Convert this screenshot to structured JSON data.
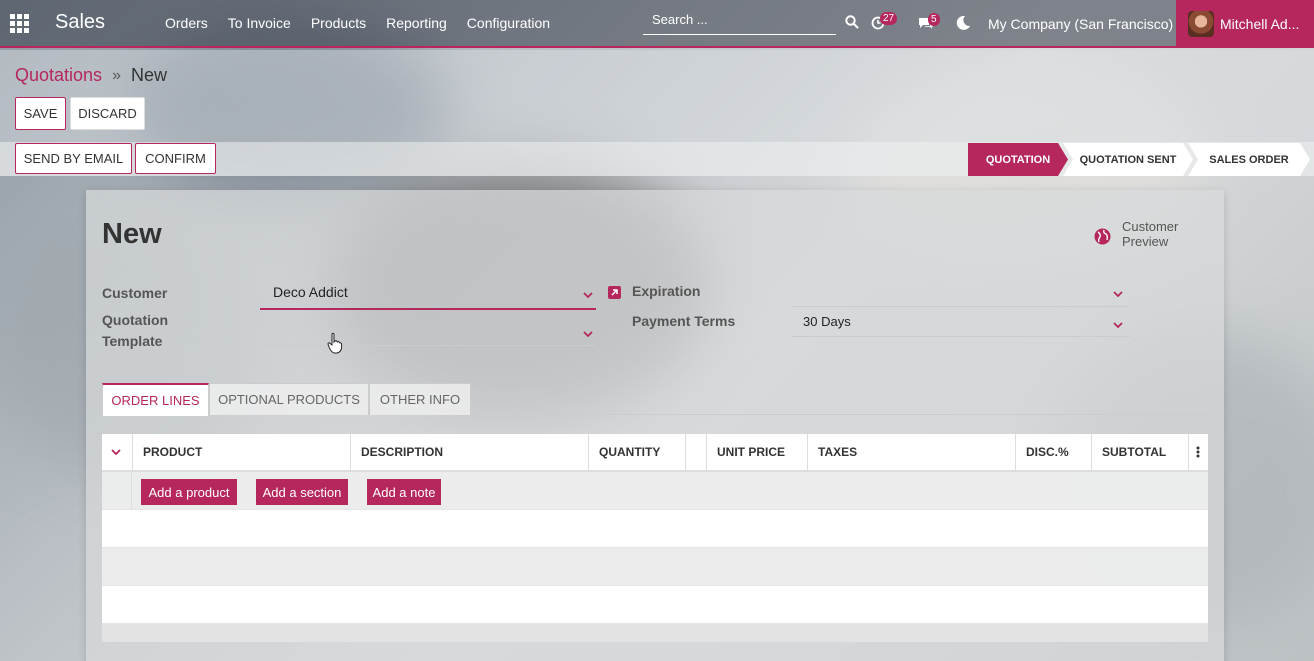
{
  "navbar": {
    "app_name": "Sales",
    "menu": [
      "Orders",
      "To Invoice",
      "Products",
      "Reporting",
      "Configuration"
    ],
    "search_placeholder": "Search ...",
    "activity_count": "27",
    "message_count": "5",
    "company": "My Company (San Francisco)",
    "user": "Mitchell Ad..."
  },
  "breadcrumb": {
    "parent": "Quotations",
    "current": "New"
  },
  "buttons": {
    "save": "SAVE",
    "discard": "DISCARD",
    "send_by_email": "SEND BY EMAIL",
    "confirm": "CONFIRM"
  },
  "statusbar": {
    "stages": [
      "QUOTATION",
      "QUOTATION SENT",
      "SALES ORDER"
    ],
    "active": "QUOTATION"
  },
  "form": {
    "title": "New",
    "customer_preview": "Customer Preview",
    "customer_label": "Customer",
    "customer_value": "Deco Addict",
    "template_label_1": "Quotation",
    "template_label_2": "Template",
    "template_value": "",
    "expiration_label": "Expiration",
    "expiration_value": "",
    "payment_terms_label": "Payment Terms",
    "payment_terms_value": "30 Days"
  },
  "tabs": [
    "ORDER LINES",
    "OPTIONAL PRODUCTS",
    "OTHER INFO"
  ],
  "table": {
    "columns": [
      "PRODUCT",
      "DESCRIPTION",
      "QUANTITY",
      "",
      "UNIT PRICE",
      "TAXES",
      "DISC.%",
      "SUBTOTAL"
    ],
    "add_product": "Add a product",
    "add_section": "Add a section",
    "add_note": "Add a note"
  },
  "colors": {
    "accent": "#b5275d"
  }
}
